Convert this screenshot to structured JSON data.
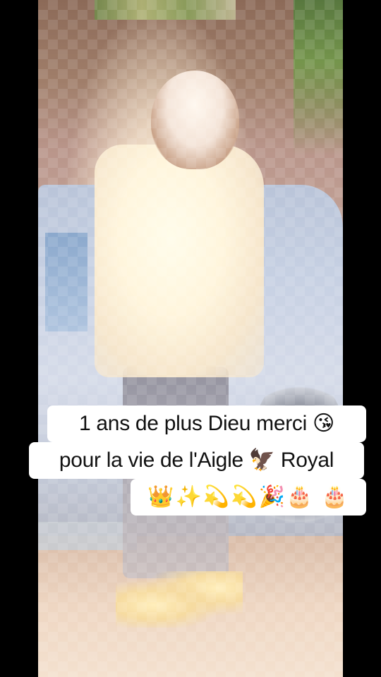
{
  "caption": {
    "line1": "1 ans de plus Dieu merci 😘",
    "line2": "pour la vie de l'Aigle 🦅 Royal",
    "line3": "👑✨💫💫🎉🎂 🎂"
  }
}
